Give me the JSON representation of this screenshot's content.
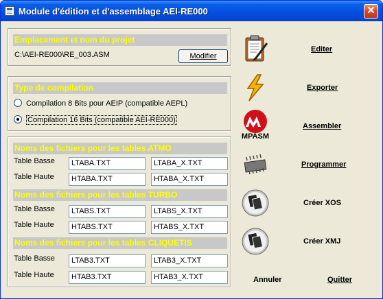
{
  "window": {
    "title": "Module d'édition et d'assemblage AEI-RE000",
    "close_glyph": "✕"
  },
  "project": {
    "header": "Emplacement et nom du projet",
    "path": "C:\\AEI-RE000\\RE_003.ASM",
    "modify_label": "Modifier"
  },
  "compilation": {
    "header": "Type de compilation",
    "options": [
      {
        "label": "Compilation 8 Bits pour AEIP (compatible AEPL)",
        "checked": false
      },
      {
        "label": "Compilation 16 Bits (compatible AEI-RE000)",
        "checked": true
      }
    ]
  },
  "tables": {
    "row_labels": {
      "basse": "Table Basse",
      "haute": "Table Haute"
    },
    "groups": [
      {
        "header": "Noms des fichiers pour les tables ATMO",
        "basse": [
          "LTABA.TXT",
          "LTABA_X.TXT"
        ],
        "haute": [
          "HTABA.TXT",
          "HTABA_X.TXT"
        ]
      },
      {
        "header": "Noms des fichiers pour les tables TURBO",
        "basse": [
          "LTABS.TXT",
          "LTABS_X.TXT"
        ],
        "haute": [
          "HTABS.TXT",
          "HTABS_X.TXT"
        ]
      },
      {
        "header": "Noms des fichiers pour les tables CLIQUETIS",
        "basse": [
          "LTAB3.TXT",
          "LTAB3_X.TXT"
        ],
        "haute": [
          "HTAB3.TXT",
          "HTAB3_X.TXT"
        ]
      }
    ]
  },
  "actions": {
    "editer": "Editer",
    "exporter": "Exporter",
    "assembler": "Assembler",
    "programmer": "Programmer",
    "creer_xos": "Créer XOS",
    "creer_xmj": "Créer XMJ",
    "annuler": "Annuler",
    "quitter": "Quitter",
    "mpasm_logo_text": "MPASM"
  },
  "colors": {
    "titlebar": "#0450e0",
    "group_header_bg": "#c8c8c8",
    "group_header_text": "#ffff00",
    "window_bg": "#ece9d8"
  }
}
